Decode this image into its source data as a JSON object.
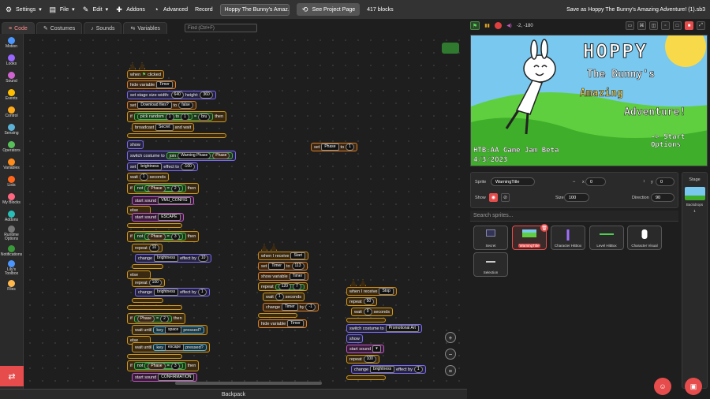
{
  "menu": {
    "settings": "Settings",
    "file": "File",
    "edit": "Edit",
    "addons": "Addons",
    "advanced": "Advanced",
    "record": "Record",
    "project_title": "Hoppy The Bunny's Amaz...",
    "see_project_page": "See Project Page",
    "block_count": "417 blocks",
    "save_as": "Save as Hoppy The Bunny's Amazing Adventure! (1).sb3"
  },
  "tabs": {
    "code": "Code",
    "costumes": "Costumes",
    "sounds": "Sounds",
    "variables": "Variables",
    "find_placeholder": "Find (Ctrl+F)"
  },
  "palette": [
    {
      "label": "Motion",
      "color": "#4c97ff"
    },
    {
      "label": "Looks",
      "color": "#9966ff"
    },
    {
      "label": "Sound",
      "color": "#cf63cf"
    },
    {
      "label": "Events",
      "color": "#ffbf00"
    },
    {
      "label": "Control",
      "color": "#ffab19"
    },
    {
      "label": "Sensing",
      "color": "#5cb1d6"
    },
    {
      "label": "Operators",
      "color": "#59c059"
    },
    {
      "label": "Variables",
      "color": "#ff8c1a"
    },
    {
      "label": "Lists",
      "color": "#ff661a"
    },
    {
      "label": "My Blocks",
      "color": "#ff6680"
    },
    {
      "label": "Addons",
      "color": "#29beb8"
    },
    {
      "label": "Runtime Options",
      "color": "#777777"
    },
    {
      "label": "Notifications",
      "color": "#3a9a3a"
    },
    {
      "label": "Lily's Toolbox",
      "color": "#4c97ff"
    },
    {
      "label": "Files",
      "color": "#ffb84d"
    }
  ],
  "workspace": {
    "script1": {
      "when": "when",
      "clicked": "clicked",
      "hide_variable": "hide variable",
      "timer": "Timer",
      "set_stage_size": "set stage size width:",
      "w": "640",
      "height": "height:",
      "h": "360",
      "set": "set",
      "download_files": "Download files?",
      "to": "to",
      "false": "false",
      "if": "if",
      "pick_random": "pick random",
      "one": "1",
      "one_b": "1",
      "eq": "=",
      "bru": "bru",
      "then": "then",
      "broadcast": "broadcast",
      "secret": "Secret",
      "and_wait": "and wait",
      "show": "show",
      "switch_costume": "switch costume to",
      "join": "join",
      "warning_phase": "Warning Phase",
      "phase": "Phase",
      "set_effect": "set",
      "brightness": "brightness",
      "effect_to": "effect to",
      "m100": "-100",
      "wait": "wait",
      "wait_n": "1",
      "seconds": "seconds",
      "if2": "if",
      "not": "not",
      "phase2": "Phase",
      "eq2": "=",
      "two": "2",
      "then2": "then",
      "start_sound": "start sound",
      "vmu_config": "VMU_CONFIG",
      "else": "else",
      "start_sound2": "start sound",
      "escape": "ESCAPE",
      "if3": "if",
      "not3": "not",
      "phase3": "Phase",
      "three": "3",
      "then3": "then",
      "repeat": "repeat",
      "ten": "10",
      "change": "change",
      "brightness2": "brightness",
      "effect_by": "effect by",
      "ten2": "10",
      "else2": "else",
      "repeat2": "repeat",
      "hundred": "100",
      "change2": "change",
      "brightness3": "brightness",
      "effect_by2": "effect by",
      "one2": "1",
      "if4": "if",
      "phase4": "Phase",
      "two4": "2",
      "then4": "then",
      "wait_until": "wait until",
      "key": "key",
      "space": "space",
      "pressed": "pressed?",
      "else3": "else",
      "wait_until2": "wait until",
      "key2": "key",
      "escape2": "escape",
      "pressed2": "pressed?",
      "if5": "if",
      "not5": "not",
      "phase5": "Phase",
      "three5": "3",
      "then5": "then",
      "start_sound3": "start sound",
      "confirmation": "CONFIRMATION"
    },
    "loose_block": {
      "set": "set",
      "phase": "Phase",
      "to": "to",
      "value": "1"
    },
    "script2": {
      "when_receive": "when I receive",
      "start": "Start",
      "set": "set",
      "timer": "Timer",
      "to": "to",
      "v": "113",
      "show_variable": "show variable",
      "timer2": "Timer",
      "repeat": "repeat",
      "r120": "120",
      "r7": "7",
      "wait": "wait",
      "w1": "1",
      "seconds": "seconds",
      "change": "change",
      "timer3": "Timer",
      "by": "by",
      "m1": "-1",
      "hide_variable": "hide variable",
      "timer4": "Timer"
    },
    "script3": {
      "when_receive": "when I receive",
      "stop": "Stop",
      "repeat": "repeat",
      "r50": "50",
      "wait": "wait",
      "w0": "0",
      "seconds": "seconds",
      "switch_costume": "switch costume to",
      "promo": "Promotional Art",
      "show": "show",
      "start_sound": "start sound",
      "repeat2": "repeat",
      "r100": "100",
      "change": "change",
      "brightness": "brightness",
      "effect_by": "effect by",
      "one": "1"
    },
    "backpack": "Backpack"
  },
  "stage_controls": {
    "coords": "-2, -180"
  },
  "stage": {
    "title_line1": "HOPPY",
    "title_line2": "The Bunny's",
    "title_line3": "Amazing",
    "title_line4": "Adventure!",
    "start_hint": "-> Start\nOptions",
    "jam_line1": "HTB:AA Game Jam Beta",
    "jam_line2": "4/3/2023"
  },
  "sprite_info": {
    "sprite_label": "Sprite",
    "sprite_name": "WarningTitle",
    "x_label": "x",
    "x": "0",
    "y_label": "y",
    "y": "0",
    "show_label": "Show",
    "size_label": "Size",
    "size": "100",
    "direction_label": "Direction",
    "direction": "90"
  },
  "sprites": {
    "search_placeholder": "Search sprites...",
    "items": [
      "Secret",
      "WarningTitle",
      "Character HitBox",
      "Level HitBox",
      "Character Visual",
      "Selection"
    ]
  },
  "stage_pane": {
    "title": "Stage",
    "backdrops_label": "Backdrops",
    "backdrops_count": "1"
  }
}
